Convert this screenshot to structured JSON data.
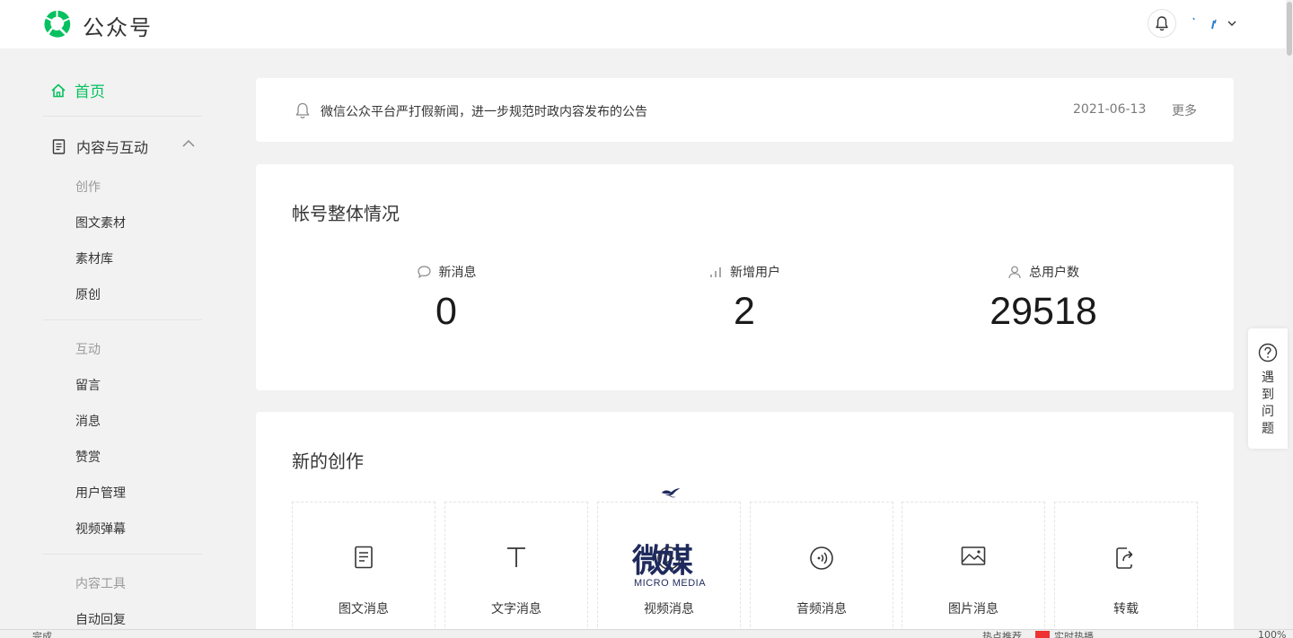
{
  "brand": {
    "name": "公众号",
    "color": "#07c160"
  },
  "sidebar": {
    "home": "首页",
    "group_content": "内容与互动",
    "section_create": "创作",
    "create_items": [
      "图文素材",
      "素材库",
      "原创"
    ],
    "section_interact": "互动",
    "interact_items": [
      "留言",
      "消息",
      "赞赏",
      "用户管理",
      "视频弹幕"
    ],
    "section_tools": "内容工具",
    "tools_items": [
      "自动回复"
    ]
  },
  "notice": {
    "text": "微信公众平台严打假新闻，进一步规范时政内容发布的公告",
    "date": "2021-06-13",
    "more": "更多"
  },
  "overview": {
    "title": "帐号整体情况",
    "stats": [
      {
        "label": "新消息",
        "value": "0",
        "icon": "chat-bubble-icon"
      },
      {
        "label": "新增用户",
        "value": "2",
        "icon": "bar-chart-icon"
      },
      {
        "label": "总用户数",
        "value": "29518",
        "icon": "user-icon"
      }
    ]
  },
  "create": {
    "title": "新的创作",
    "tiles": [
      {
        "label": "图文消息",
        "icon": "document-icon"
      },
      {
        "label": "文字消息",
        "icon": "text-icon"
      },
      {
        "label": "视频消息",
        "icon": "video-icon"
      },
      {
        "label": "音频消息",
        "icon": "audio-icon"
      },
      {
        "label": "图片消息",
        "icon": "image-icon"
      },
      {
        "label": "转载",
        "icon": "share-icon"
      }
    ]
  },
  "watermark": {
    "text": "微媒",
    "sub": "MICRO  MEDIA"
  },
  "help": {
    "text": "遇到问题"
  },
  "statusbar": {
    "left": "完成",
    "item1": "热点推荐",
    "item2": "实时热播",
    "zoom": "100%"
  }
}
